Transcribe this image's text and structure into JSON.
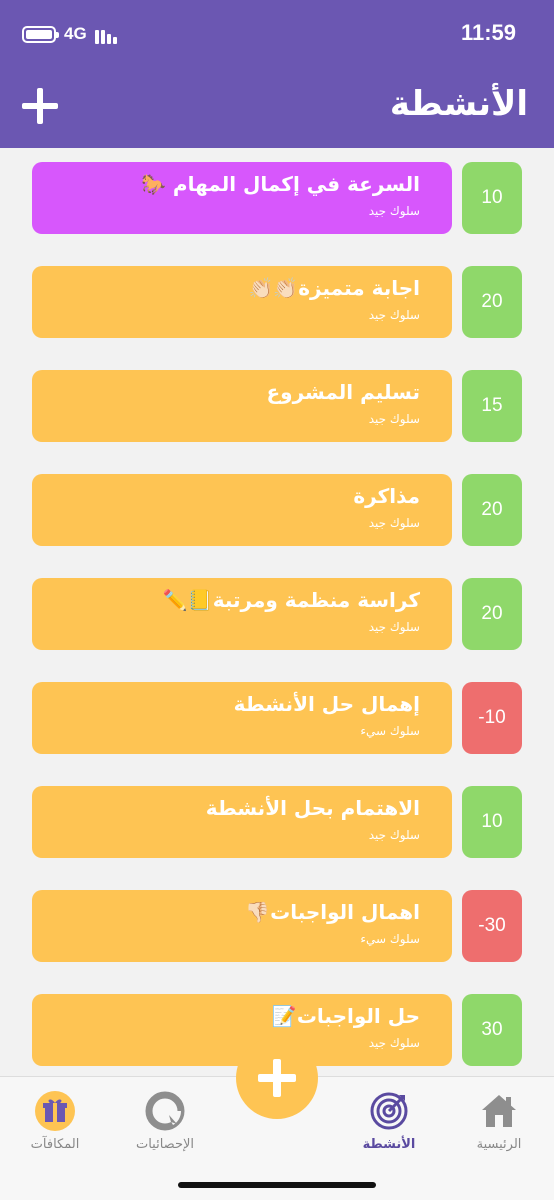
{
  "status_bar": {
    "network": "4G",
    "time": "11:59"
  },
  "header": {
    "title": "الأنشطة"
  },
  "activities": [
    {
      "title": "السرعة في إكمال المهام 🐎",
      "subtitle": "سلوك جيد",
      "points": "10",
      "type": "positive",
      "color": "#d757fc"
    },
    {
      "title": "اجابة متميزة👏🏻👏🏻",
      "subtitle": "سلوك جيد",
      "points": "20",
      "type": "positive",
      "color": "#fec453"
    },
    {
      "title": "تسليم المشروع",
      "subtitle": "سلوك جيد",
      "points": "15",
      "type": "positive",
      "color": "#fec453"
    },
    {
      "title": "مذاكرة",
      "subtitle": "سلوك جيد",
      "points": "20",
      "type": "positive",
      "color": "#fec453"
    },
    {
      "title": "كراسة منظمة ومرتبة📒✏️",
      "subtitle": "سلوك جيد",
      "points": "20",
      "type": "positive",
      "color": "#fec453"
    },
    {
      "title": "إهمال حل الأنشطة",
      "subtitle": "سلوك سيء",
      "points": "-10",
      "type": "negative",
      "color": "#fec453"
    },
    {
      "title": "الاهتمام بحل الأنشطة",
      "subtitle": "سلوك جيد",
      "points": "10",
      "type": "positive",
      "color": "#fec453"
    },
    {
      "title": "اهمال الواجبات👎🏻",
      "subtitle": "سلوك سيء",
      "points": "-30",
      "type": "negative",
      "color": "#fec453"
    },
    {
      "title": "حل الواجبات📝",
      "subtitle": "سلوك جيد",
      "points": "30",
      "type": "positive",
      "color": "#fec453"
    }
  ],
  "tabs": [
    {
      "label": "المكافآت",
      "icon": "gift-icon"
    },
    {
      "label": "الإحصائيات",
      "icon": "pie-chart-icon"
    },
    {
      "label": "الأنشطة",
      "icon": "target-icon",
      "active": true
    },
    {
      "label": "الرئيسية",
      "icon": "home-icon"
    }
  ],
  "colors": {
    "header": "#6b57b2",
    "positive": "#8fd86a",
    "negative": "#ee6e6e",
    "card": "#fec453",
    "card_highlight": "#d757fc"
  }
}
